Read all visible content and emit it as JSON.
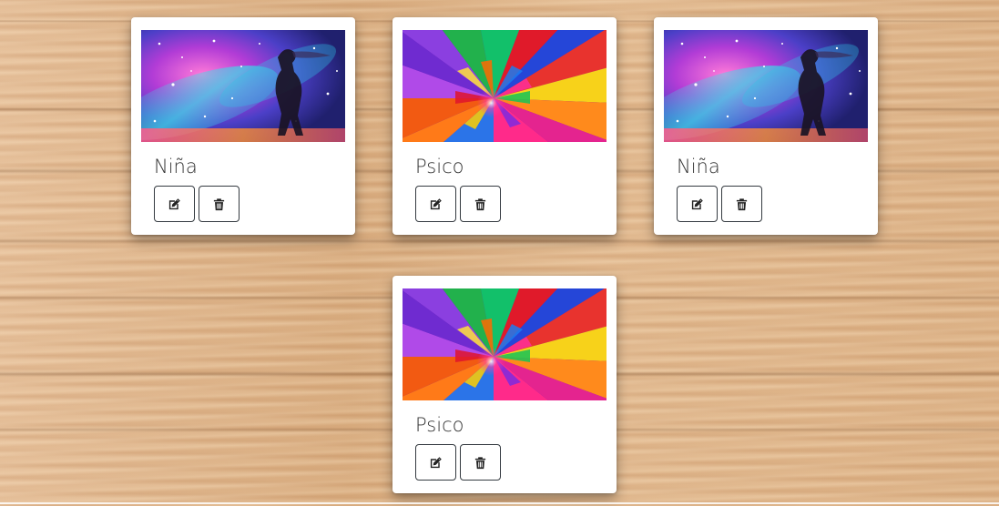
{
  "cards": [
    {
      "title": "Niña",
      "image": "galaxy-girl-image",
      "edit_icon": "edit-icon",
      "delete_icon": "trash-icon"
    },
    {
      "title": "Psico",
      "image": "psychedelic-swirl-image",
      "edit_icon": "edit-icon",
      "delete_icon": "trash-icon"
    },
    {
      "title": "Niña",
      "image": "galaxy-girl-image",
      "edit_icon": "edit-icon",
      "delete_icon": "trash-icon"
    },
    {
      "title": "Psico",
      "image": "psychedelic-swirl-image",
      "edit_icon": "edit-icon",
      "delete_icon": "trash-icon"
    }
  ],
  "colors": {
    "card_background": "#ffffff",
    "button_border": "#343a40",
    "title_text": "#333333"
  }
}
